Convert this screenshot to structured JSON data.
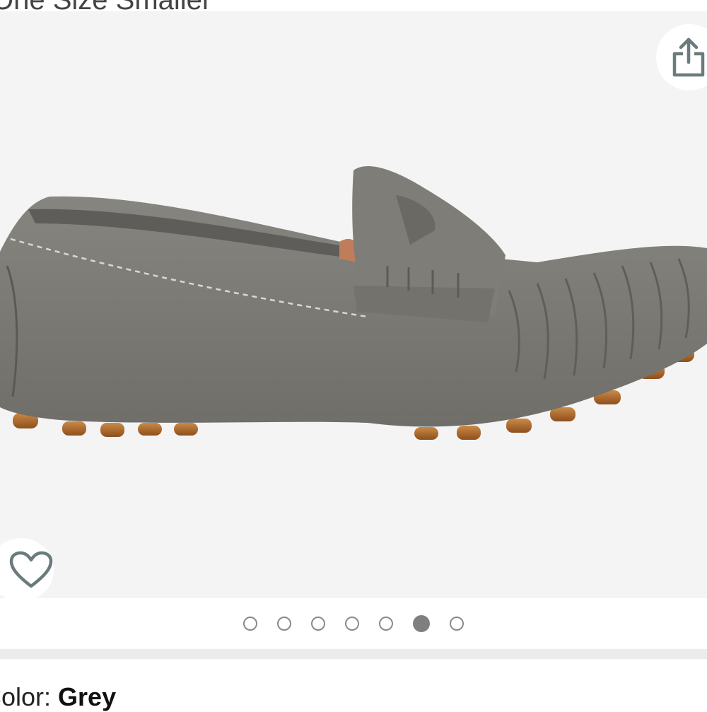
{
  "top_text": "One Size Smaller",
  "gallery": {
    "image_alt": "Grey suede penny loafer",
    "dots_total": 7,
    "active_index": 5
  },
  "icons": {
    "share": "share-icon",
    "wishlist": "heart-icon"
  },
  "color": {
    "label": "Color: ",
    "value": "Grey"
  },
  "colors": {
    "suede": "#7b7a76",
    "sole_nub": "#b7702f",
    "background": "#f4f4f4",
    "dot_active": "#7f7f7f",
    "icon": "#6b7b7d"
  }
}
